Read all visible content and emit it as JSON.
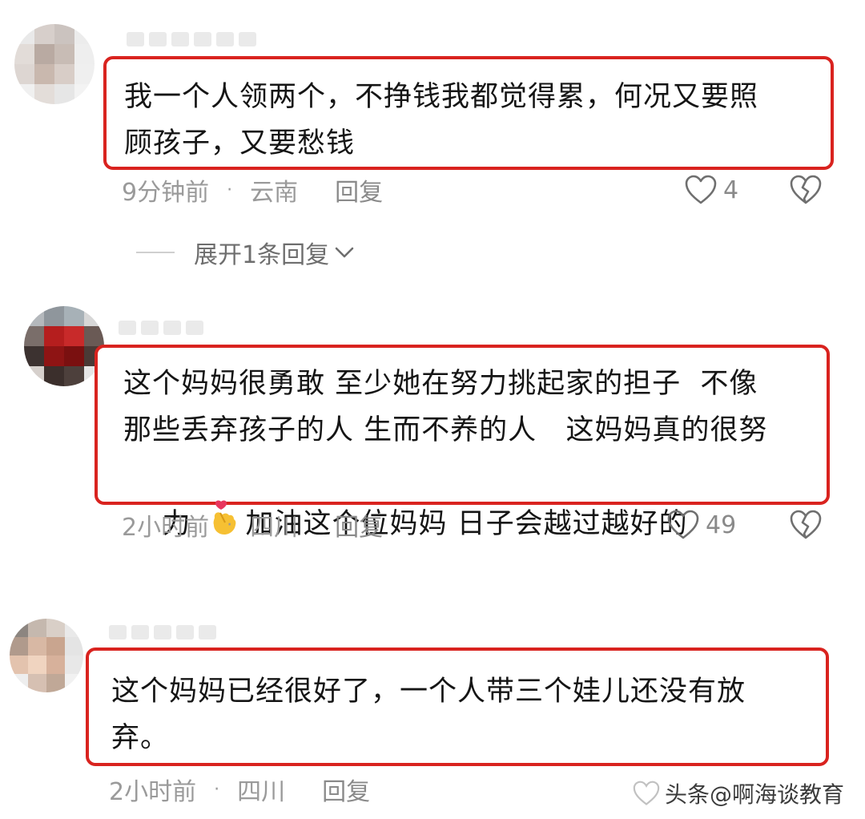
{
  "comments": [
    {
      "text_lines": [
        "我一个人领两个，不挣钱我都觉得累，何况又要照",
        "顾孩子，又要愁钱"
      ],
      "time": "9分钟前",
      "location": "云南",
      "reply": "回复",
      "likes": "4",
      "expand": "展开1条回复"
    },
    {
      "text_lines": [
        "这个妈妈很勇敢 至少她在努力挑起家的担子  不像",
        "那些丢弃孩子的人 生而不养的人   这妈妈真的很努"
      ],
      "text_line3_before": "力",
      "text_line3_after": "加油这个位妈妈 日子会越过越好的",
      "time": "2小时前",
      "location": "四川",
      "reply": "回复",
      "likes": "49"
    },
    {
      "text_lines": [
        "这个妈妈已经很好了，一个人带三个娃儿还没有放",
        "弃。"
      ],
      "time": "2小时前",
      "location": "四川",
      "reply": "回复"
    }
  ],
  "separator": "·",
  "watermark": "头条@啊海谈教育",
  "accent_color": "#d9231f",
  "icons": [
    "heart-icon",
    "broken-heart-icon",
    "chevron-down-icon",
    "finger-heart-emoji"
  ]
}
